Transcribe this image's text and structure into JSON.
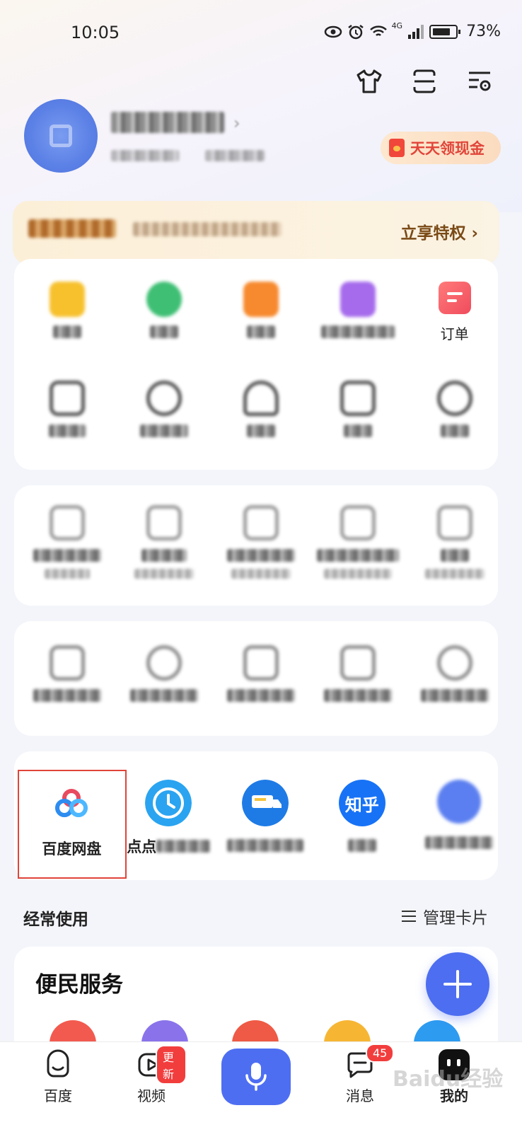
{
  "status_bar": {
    "time": "10:05",
    "network": "4G",
    "battery": "73%"
  },
  "header": {
    "icons": [
      "tshirt-icon",
      "scan-icon",
      "settings-icon"
    ],
    "gold_button": "天天领现金"
  },
  "vip_banner": {
    "cta": "立享特权 ›"
  },
  "shortcuts": {
    "row1_visible_label": "订单"
  },
  "apps": [
    {
      "label": "百度网盘",
      "icon": "baidu-netdisk-icon"
    },
    {
      "label": "点点",
      "icon": "clock-app-icon"
    },
    {
      "label": "",
      "icon": "truck-app-icon"
    },
    {
      "label": "",
      "icon": "zhihu-icon",
      "icon_text": "知乎"
    },
    {
      "label": "",
      "icon": "blurred-app-icon"
    }
  ],
  "frequent": {
    "title": "经常使用",
    "manage": "管理卡片"
  },
  "services": {
    "title": "便民服务"
  },
  "bottom_nav": [
    {
      "label": "百度",
      "icon": "baidu-home-icon"
    },
    {
      "label": "视频",
      "icon": "video-icon",
      "badge": "更新"
    },
    {
      "label": "",
      "icon": "mic-icon"
    },
    {
      "label": "消息",
      "icon": "message-icon",
      "badge": "45"
    },
    {
      "label": "我的",
      "icon": "profile-icon"
    }
  ],
  "watermark": "Baidu经验",
  "colors": {
    "accent": "#4e6ef2",
    "badge": "#f23d3d",
    "highlight_border": "#e0443a",
    "vip_text": "#7a4a16"
  }
}
